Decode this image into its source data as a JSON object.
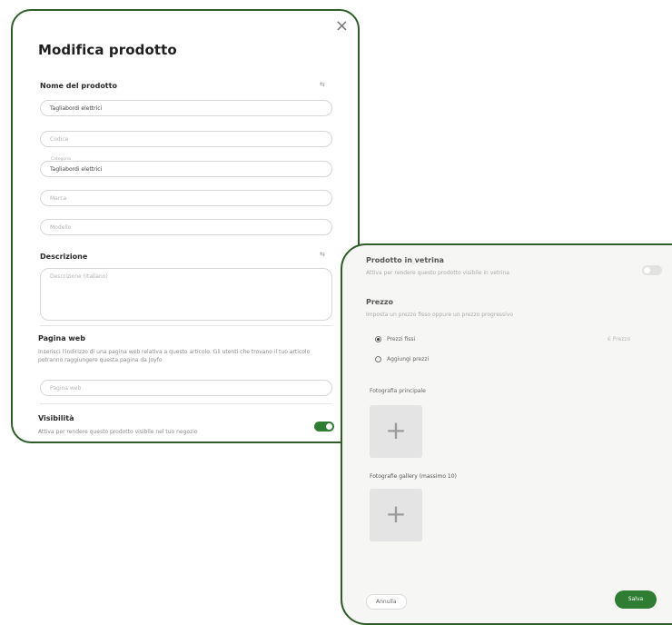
{
  "edit_dialog": {
    "title": "Modifica prodotto",
    "close_icon": "×",
    "product_name_label": "Nome del prodotto",
    "product_name_value": "Tagliabordi elettrici",
    "code_placeholder": "Codice",
    "category_label": "Categoria",
    "category_value": "Tagliabordi elettrici",
    "brand_placeholder": "Marca",
    "model_placeholder": "Modello",
    "description_label": "Descrizione",
    "description_placeholder": "Descrizione (Italiano)",
    "webpage_label": "Pagina web",
    "webpage_hint": "Inserisci l'indirizzo di una pagina web relativa a questo articolo. Gli utenti che trovano il tuo articolo potranno raggiungere questa pagina da Joyfo",
    "webpage_placeholder": "Pagina web",
    "visibility_label": "Visibilità",
    "visibility_hint": "Attiva per rendere questo prodotto visibile nel tuo negozio",
    "visibility_on": true,
    "accent_color": "#2e7d32"
  },
  "secondary_panel": {
    "featured_label": "Prodotto in vetrina",
    "featured_hint": "Attiva per rendere questo prodotto visibile in vetrina",
    "price_label": "Prezzo",
    "price_hint": "Imposta un prezzo fisso oppure un prezzo progressivo",
    "fixed_price_label": "Prezzi fissi",
    "price_value": "€ Prezzo",
    "add_range_label": "Aggiungi prezzi",
    "main_photo_label": "Fotografia principale",
    "gallery_label": "Fotografie gallery (massimo 10)",
    "cancel_label": "Annulla",
    "save_label": "Salva",
    "plus_icon": "+"
  }
}
